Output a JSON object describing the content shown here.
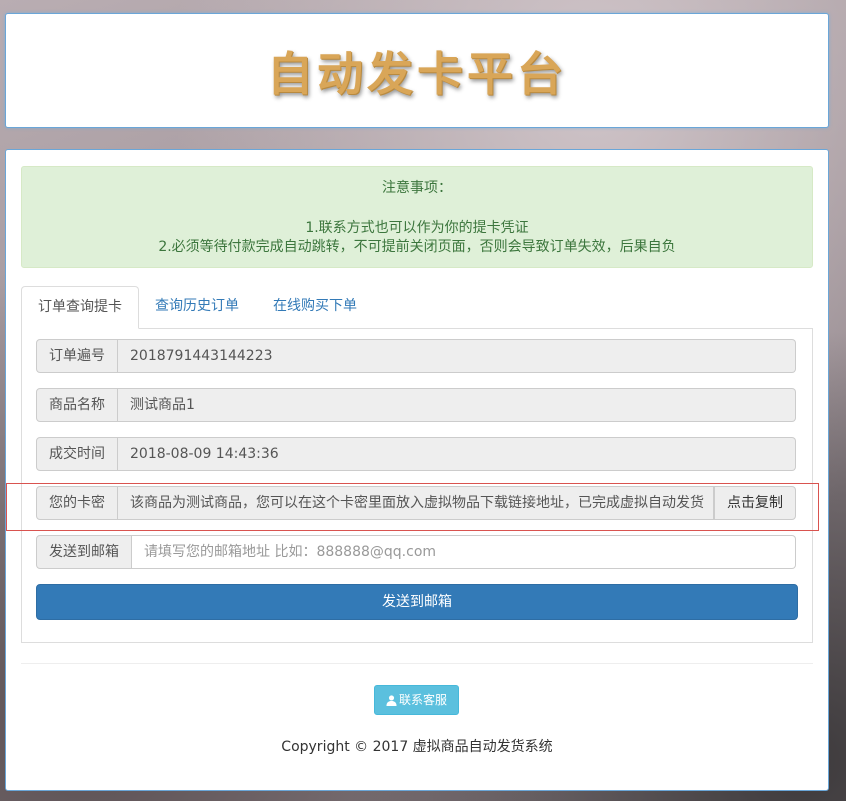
{
  "header": {
    "title": "自动发卡平台"
  },
  "notice": {
    "title": "注意事项：",
    "line1": "1.联系方式也可以作为你的提卡凭证",
    "line2": "2.必须等待付款完成自动跳转，不可提前关闭页面，否则会导致订单失效，后果自负"
  },
  "tabs": [
    {
      "label": "订单查询提卡",
      "active": true
    },
    {
      "label": "查询历史订单",
      "active": false
    },
    {
      "label": "在线购买下单",
      "active": false
    }
  ],
  "order": {
    "order_no_label": "订单遍号",
    "order_no_value": "2018791443144223",
    "product_label": "商品名称",
    "product_value": "测试商品1",
    "time_label": "成交时间",
    "time_value": "2018-08-09 14:43:36",
    "card_label": "您的卡密",
    "card_value": "该商品为测试商品，您可以在这个卡密里面放入虚拟物品下载链接地址，已完成虚拟自动发货",
    "copy_label": "点击复制",
    "email_label": "发送到邮箱",
    "email_placeholder": "请填写您的邮箱地址 比如：888888@qq.com",
    "send_label": "发送到邮箱"
  },
  "contact": {
    "label": "联系客服",
    "icon": "user-icon"
  },
  "footer": {
    "copyright": "Copyright © 2017 虚拟商品自动发货系统"
  },
  "colors": {
    "primary": "#337ab7",
    "info": "#5bc0de",
    "success_bg": "#dff0d8",
    "success_text": "#3c763d",
    "highlight_border": "#d9534f",
    "title_gold": "#d9a658"
  }
}
